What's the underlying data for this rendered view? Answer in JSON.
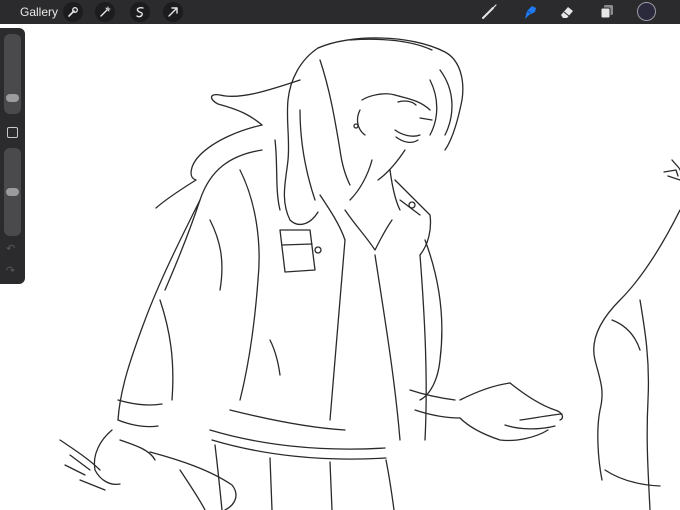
{
  "topbar": {
    "gallery_label": "Gallery",
    "left_tools": [
      {
        "name": "wrench-icon"
      },
      {
        "name": "magic-wand-icon"
      },
      {
        "name": "selection-icon"
      },
      {
        "name": "transform-arrow-icon"
      }
    ],
    "right_tools": [
      {
        "name": "brush-icon",
        "active": false
      },
      {
        "name": "smudge-icon",
        "active": true
      },
      {
        "name": "eraser-icon",
        "active": false
      },
      {
        "name": "layers-icon",
        "active": false
      }
    ],
    "current_color": "#2a2a3c",
    "accent_color": "#1e7bf2"
  },
  "sidebar": {
    "brush_size_level": 0.25,
    "opacity_level": 0.5,
    "undo_icon": "undo-icon",
    "redo_icon": "redo-icon"
  }
}
